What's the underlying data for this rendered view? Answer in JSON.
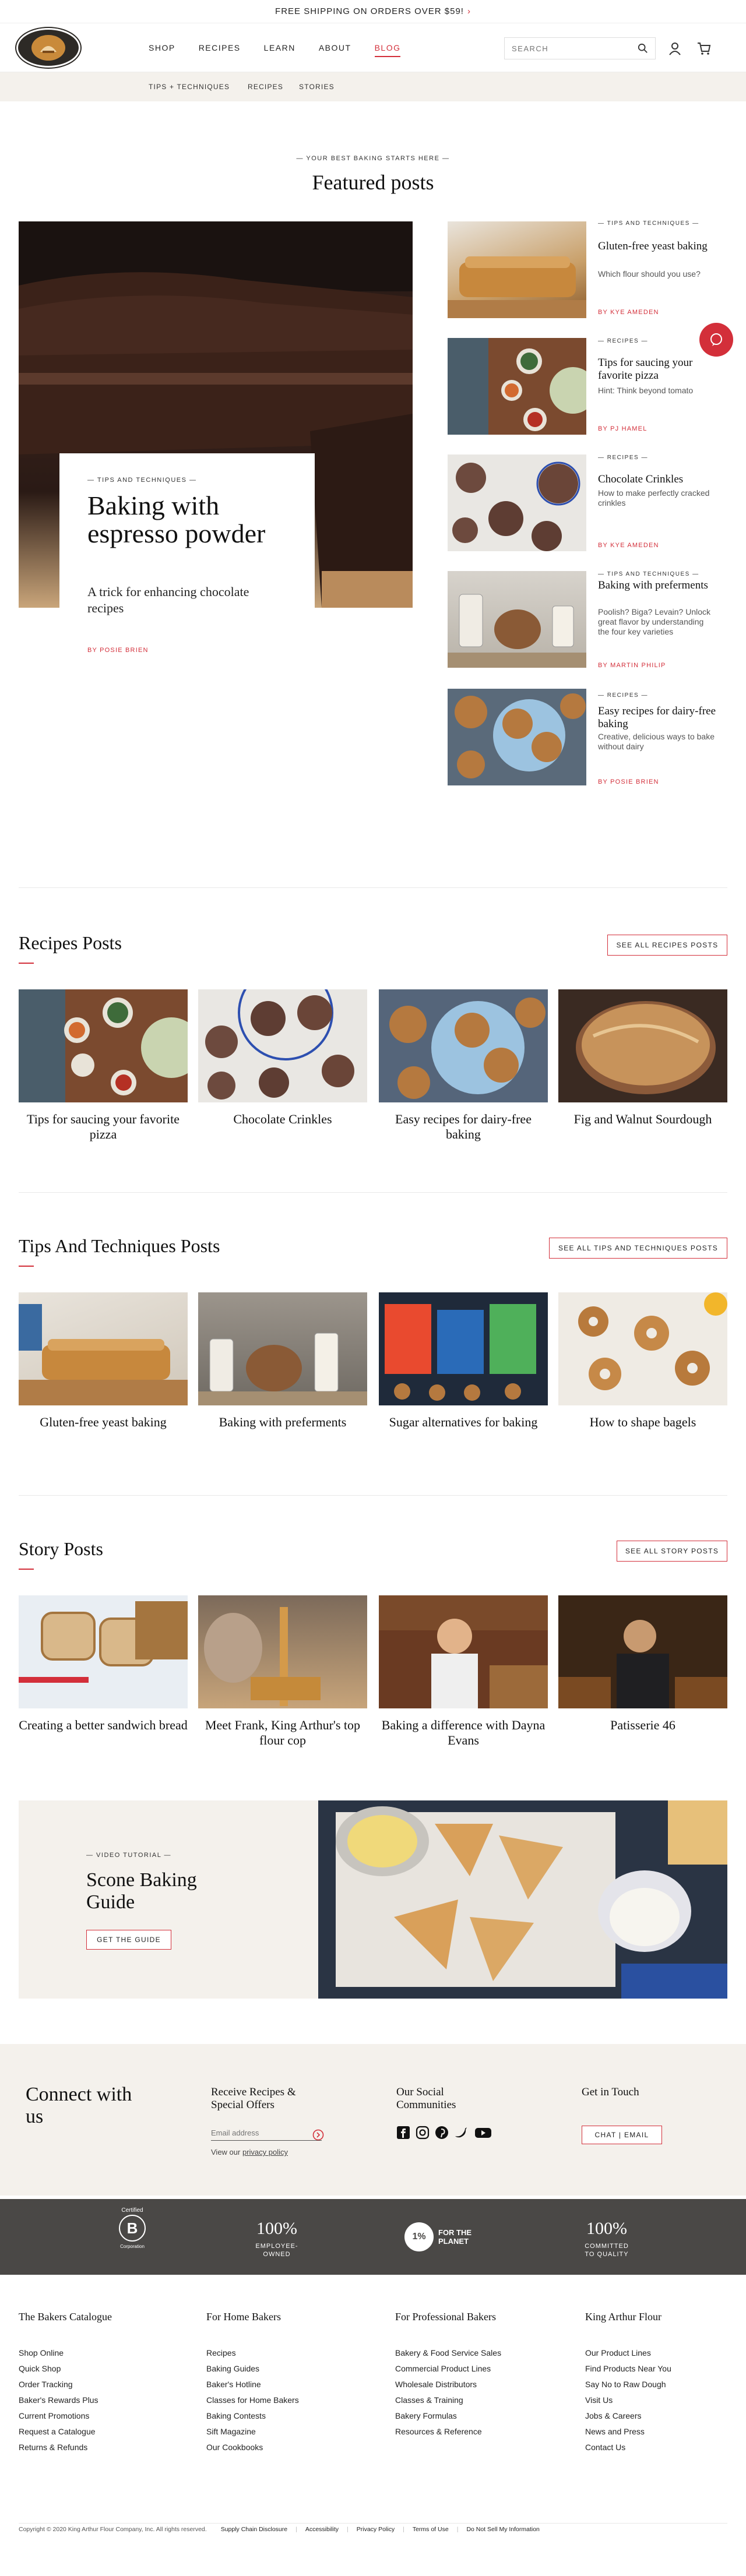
{
  "banner": {
    "text": "FREE SHIPPING ON ORDERS OVER $59!",
    "chevron": "›"
  },
  "header": {
    "logo_text": "King Arthur Flour",
    "nav": [
      "SHOP",
      "RECIPES",
      "LEARN",
      "ABOUT",
      "BLOG"
    ],
    "active_nav": "BLOG",
    "search_placeholder": "SEARCH"
  },
  "subnav": [
    "TIPS + TECHNIQUES",
    "RECIPES",
    "STORIES"
  ],
  "featured": {
    "eyebrow": "— YOUR BEST BAKING STARTS HERE —",
    "title": "Featured posts",
    "main": {
      "category": "— TIPS AND TECHNIQUES —",
      "title": "Baking with espresso powder",
      "desc": "A trick for enhancing chocolate recipes",
      "byline": "BY POSIE BRIEN"
    },
    "side": [
      {
        "category": "— TIPS AND TECHNIQUES —",
        "title": "Gluten-free yeast baking",
        "desc": "Which flour should you use?",
        "byline": "BY KYE AMEDEN"
      },
      {
        "category": "— RECIPES —",
        "title": "Tips for saucing your favorite pizza",
        "desc": "Hint: Think beyond tomato",
        "byline": "BY PJ HAMEL"
      },
      {
        "category": "— RECIPES —",
        "title": "Chocolate Crinkles",
        "desc": "How to make perfectly cracked crinkles",
        "byline": "BY KYE AMEDEN"
      },
      {
        "category": "— TIPS AND TECHNIQUES —",
        "title": "Baking with preferments",
        "desc": "Poolish? Biga? Levain? Unlock great flavor by understanding the four key varieties",
        "byline": "BY MARTIN PHILIP"
      },
      {
        "category": "— RECIPES —",
        "title": "Easy recipes for dairy-free baking",
        "desc": "Creative, delicious ways to bake without dairy",
        "byline": "BY POSIE BRIEN"
      }
    ]
  },
  "recipes_section": {
    "title": "Recipes Posts",
    "button": "SEE ALL RECIPES POSTS",
    "cards": [
      "Tips for saucing your favorite pizza",
      "Chocolate Crinkles",
      "Easy recipes for dairy-free baking",
      "Fig and Walnut Sourdough"
    ]
  },
  "tips_section": {
    "title": "Tips And Techniques Posts",
    "button": "SEE ALL TIPS AND TECHNIQUES POSTS",
    "cards": [
      "Gluten-free yeast baking",
      "Baking with preferments",
      "Sugar alternatives for baking",
      "How to shape bagels"
    ]
  },
  "story_section": {
    "title": "Story Posts",
    "button": "SEE ALL STORY POSTS",
    "cards": [
      "Creating a better sandwich bread",
      "Meet Frank, King Arthur's top flour cop",
      "Baking a difference with Dayna Evans",
      "Patisserie 46"
    ]
  },
  "tutorial": {
    "eyebrow": "— VIDEO TUTORIAL —",
    "title": "Scone Baking Guide",
    "button": "GET THE GUIDE"
  },
  "connect": {
    "title": "Connect with us",
    "receive_title": "Receive Recipes & Special Offers",
    "email_placeholder": "Email address",
    "policy_prefix": "View our ",
    "policy_link": "privacy policy",
    "social_title": "Our Social Communities",
    "touch_title": "Get in Touch",
    "touch_button": "CHAT | EMAIL"
  },
  "stats": {
    "certified_small": "Certified",
    "b_letter": "B",
    "corporation": "Corporation",
    "items": [
      {
        "big": "100%",
        "small": "EMPLOYEE-OWNED"
      },
      {
        "big": "1%",
        "small": "FOR THE PLANET"
      },
      {
        "big": "100%",
        "small": "COMMITTED TO QUALITY"
      }
    ]
  },
  "footer": {
    "columns": [
      {
        "title": "The Bakers Catalogue",
        "links": [
          "Shop Online",
          "Quick Shop",
          "Order Tracking",
          "Baker's Rewards Plus",
          "Current Promotions",
          "Request a Catalogue",
          "Returns & Refunds"
        ]
      },
      {
        "title": "For Home Bakers",
        "links": [
          "Recipes",
          "Baking Guides",
          "Baker's Hotline",
          "Classes for Home Bakers",
          "Baking Contests",
          "Sift Magazine",
          "Our Cookbooks"
        ]
      },
      {
        "title": "For Professional Bakers",
        "links": [
          "Bakery & Food Service Sales",
          "Commercial Product Lines",
          "Wholesale Distributors",
          "Classes & Training",
          "Bakery Formulas",
          "Resources & Reference"
        ]
      },
      {
        "title": "King Arthur Flour",
        "links": [
          "Our Product Lines",
          "Find Products Near You",
          "Say No to Raw Dough",
          "Visit Us",
          "Jobs & Careers",
          "News and Press",
          "Contact Us"
        ]
      }
    ],
    "copyright": "Copyright © 2020 King Arthur Flour Company, Inc. All rights reserved.",
    "legal": [
      "Supply Chain Disclosure",
      "Accessibility",
      "Privacy Policy",
      "Terms of Use",
      "Do Not Sell My Information"
    ]
  },
  "colors": {
    "accent": "#d32f3a",
    "cream": "#f4f1ec",
    "dark_band": "#4a4846"
  }
}
